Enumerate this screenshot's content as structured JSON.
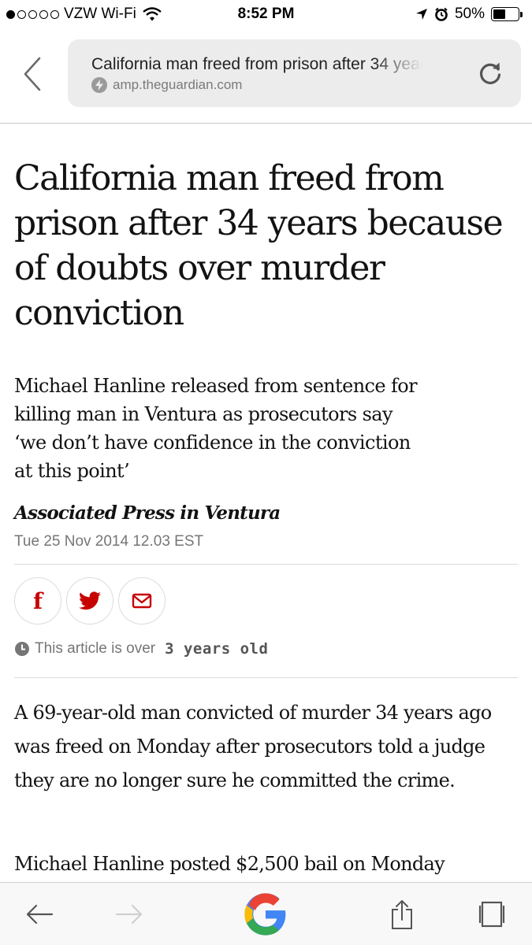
{
  "status_bar": {
    "carrier": "VZW Wi-Fi",
    "time": "8:52 PM",
    "battery_percent": "50%",
    "battery_level": 0.5,
    "signal_dots_filled": 1,
    "signal_dots_total": 5
  },
  "browser": {
    "page_title": "California man freed from prison after 34 years because of doubts over murder conviction",
    "domain": "amp.theguardian.com"
  },
  "article": {
    "headline": "California man freed from prison after 34 years because of doubts over murder conviction",
    "standfirst": "Michael Hanline released from sentence for killing man in Ventura as prosecutors say ‘we don’t have confidence in the conviction at this point’",
    "byline": "Associated Press in Ventura",
    "date": "Tue 25 Nov 2014 12.03 EST",
    "age_notice_prefix": "This article is over",
    "age_notice_value": "3 years old",
    "paragraphs": [
      "A 69-year-old man convicted of murder 34 years ago was freed on Monday after prosecutors told a judge they are no longer sure he committed the crime.",
      "Michael Hanline posted $2,500 bail on Monday"
    ]
  },
  "share": {
    "facebook_glyph": "f"
  },
  "colors": {
    "accent_red": "#c70000",
    "url_bar_bg": "#ececec",
    "meta_gray": "#767676"
  },
  "icons": [
    "wifi-icon",
    "location-arrow-icon",
    "alarm-clock-icon",
    "battery-icon",
    "back-chevron-icon",
    "amp-bolt-icon",
    "reload-icon",
    "facebook-icon",
    "twitter-icon",
    "email-icon",
    "clock-icon",
    "back-arrow-icon",
    "forward-arrow-icon",
    "google-icon",
    "share-icon",
    "tabs-icon"
  ]
}
